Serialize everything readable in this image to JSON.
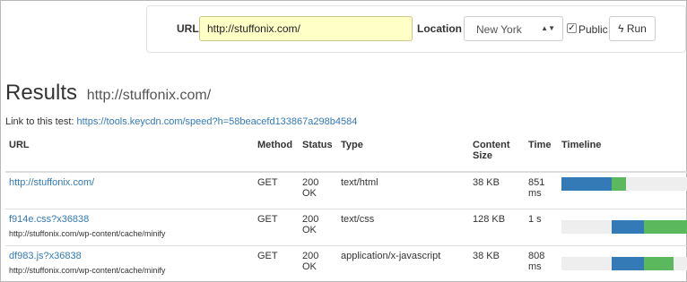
{
  "toolbar": {
    "url_label": "URL",
    "url_value": "http://stuffonix.com/",
    "location_label": "Location",
    "location_value": "New York",
    "public_label": "Public",
    "public_checked": true,
    "run_label": "Run"
  },
  "results": {
    "title": "Results",
    "url": "http://stuffonix.com/",
    "link_prefix": "Link to this test:",
    "link_url": "https://tools.keycdn.com/speed?h=58beacefd133867a298b4584"
  },
  "table": {
    "headers": {
      "url": "URL",
      "method": "Method",
      "status": "Status",
      "type": "Type",
      "content_size": "Content Size",
      "time": "Time",
      "timeline": "Timeline"
    },
    "rows": [
      {
        "name": "http://stuffonix.com/",
        "path": "",
        "method": "GET",
        "status": "200 OK",
        "type": "text/html",
        "size": "38 KB",
        "time": "851 ms",
        "timeline": {
          "wait_start": 0.0,
          "wait_end": 0.37,
          "receive_end": 0.48
        }
      },
      {
        "name": "f914e.css?x36838",
        "path": "http://stuffonix.com/wp-content/cache/minify",
        "method": "GET",
        "status": "200 OK",
        "type": "text/css",
        "size": "128 KB",
        "time": "1 s",
        "timeline": {
          "wait_start": 0.37,
          "wait_end": 0.61,
          "receive_end": 1.0
        }
      },
      {
        "name": "df983.js?x36838",
        "path": "http://stuffonix.com/wp-content/cache/minify",
        "method": "GET",
        "status": "200 OK",
        "type": "application/x-javascript",
        "size": "38 KB",
        "time": "808 ms",
        "timeline": {
          "wait_start": 0.37,
          "wait_end": 0.61,
          "receive_end": 0.83
        }
      }
    ]
  },
  "colors": {
    "wait": "#337ab7",
    "receive": "#5cb85c",
    "track": "#eeeeee"
  }
}
